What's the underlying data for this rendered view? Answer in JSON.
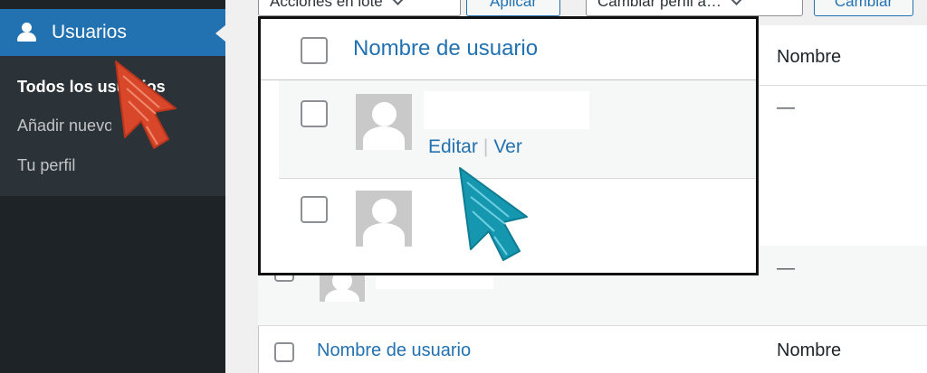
{
  "sidebar": {
    "active_menu": {
      "label": "Usuarios",
      "icon": "user-icon"
    },
    "submenu": [
      {
        "label": "Todos los usuarios",
        "current": true
      },
      {
        "label": "Añadir nuevo",
        "current": false
      },
      {
        "label": "Tu perfil",
        "current": false
      }
    ]
  },
  "toolbar": {
    "bulk_actions_value": "Acciones en lote",
    "apply_label": "Aplicar",
    "change_role_value": "Cambiar perfil a…",
    "change_label": "Cambiar"
  },
  "table": {
    "columns": {
      "username": "Nombre de usuario",
      "name": "Nombre"
    },
    "row_actions": {
      "edit": "Editar",
      "view": "Ver"
    },
    "name_placeholder": "—"
  },
  "colors": {
    "sidebar_bg": "#1d2327",
    "active_menu_bg": "#2271b1",
    "link": "#2271b1",
    "annotation_orange": "#d9472b",
    "annotation_teal": "#1597b0"
  }
}
